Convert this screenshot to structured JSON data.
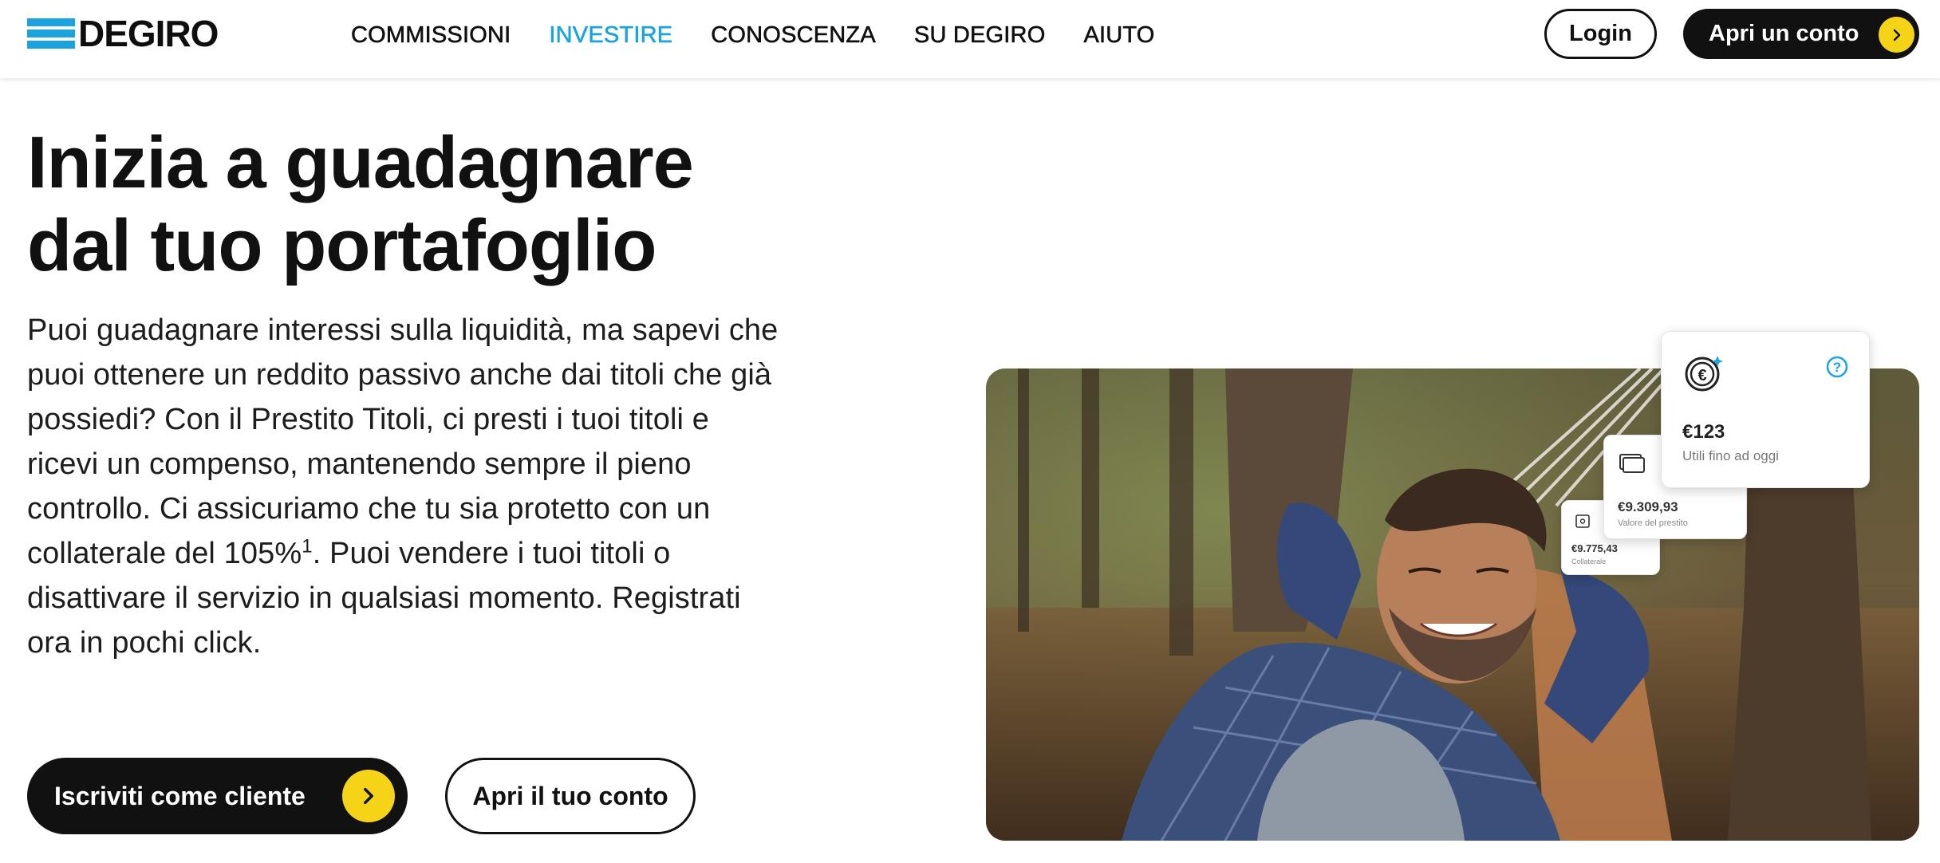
{
  "brand": {
    "name": "DEGIRO",
    "accent": "#1ba3e0",
    "yellow": "#f5d417"
  },
  "nav": {
    "items": [
      {
        "label": "COMMISSIONI",
        "active": false
      },
      {
        "label": "INVESTIRE",
        "active": true
      },
      {
        "label": "CONOSCENZA",
        "active": false
      },
      {
        "label": "SU DEGIRO",
        "active": false
      },
      {
        "label": "AIUTO",
        "active": false
      }
    ]
  },
  "header": {
    "login_label": "Login",
    "open_account_label": "Apri un conto"
  },
  "hero": {
    "title_line1": "Inizia a guadagnare",
    "title_line2": "dal tuo portafoglio",
    "body_part1": "Puoi guadagnare interessi sulla liquidità, ma sapevi che puoi ottenere un reddito passivo anche dai titoli che già possiedi? Con il Prestito Titoli, ci presti i tuoi titoli e ricevi un compenso, mantenendo sempre il pieno controllo. Ci assicuriamo che tu sia protetto con un collaterale del 105%",
    "footnote_marker": "1",
    "body_part2": ". Puoi vendere i tuoi titoli o disattivare il servizio in qualsiasi momento. Registrati ora in pochi click.",
    "cta_primary": "Iscriviti come cliente",
    "cta_secondary": "Apri il tuo conto"
  },
  "cards": {
    "collateral": {
      "value": "€9.775,43",
      "label": "Collaterale"
    },
    "loan_value": {
      "value": "€9.309,93",
      "label": "Valore del prestito"
    },
    "earnings": {
      "value": "€123",
      "label": "Utili fino ad oggi"
    }
  },
  "icons": [
    "chevron-right-icon",
    "euro-coin-icon",
    "help-icon",
    "cards-icon",
    "safe-icon"
  ]
}
